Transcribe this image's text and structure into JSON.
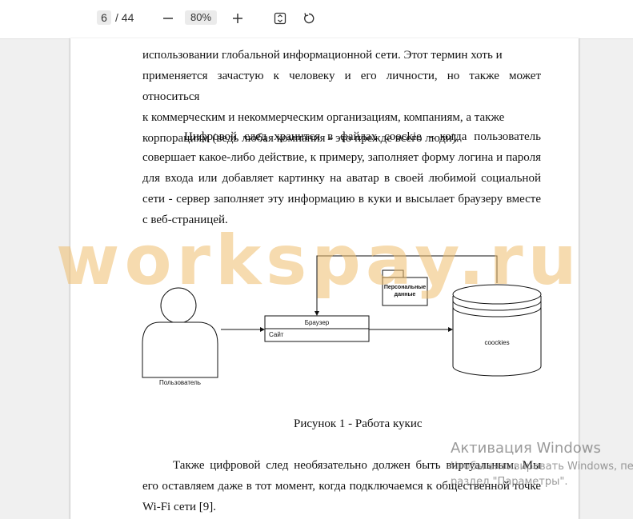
{
  "toolbar": {
    "current_page": "6",
    "page_total": "/ 44",
    "zoom": "80%",
    "zoom_out_icon": "minus-icon",
    "zoom_in_icon": "plus-icon",
    "fit_icon": "fit-page-icon",
    "rotate_icon": "rotate-icon"
  },
  "document": {
    "para1_lines": [
      "использовании глобальной информационной сети. Этот термин хоть и",
      "применяется зачастую к человеку и его личности, но также может относиться",
      "к коммерческим и некоммерческим организациям, компаниям, а также",
      "корпорациям (ведь любая компания - это прежде всего люди)."
    ],
    "para2_lines": [
      "Цифровой след хранится в файлах coockie - когда пользователь",
      "совершает какое-либо действие, к примеру, заполняет форму логина и пароля",
      "для входа или добавляет картинку на аватар в своей любимой социальной",
      "сети - сервер заполняет эту информацию в куки и высылает браузеру вместе",
      "с веб-страницей."
    ],
    "watermark": "workspay.ru",
    "diagram": {
      "user_label": "Пользователь",
      "browser_label": "Браузер",
      "site_label": "Сайт",
      "personal_data_label_1": "Персональные",
      "personal_data_label_2": "данные",
      "cookies_label": "coockies"
    },
    "caption": "Рисунок 1 - Работа кукис",
    "para3_lines": [
      "Также цифровой след необязательно должен быть виртуальным. Мы",
      "его оставляем даже в тот момент, когда подключаемся к общественной точке",
      "Wi-Fi сети [9]."
    ]
  },
  "activation": {
    "title": "Активация Windows",
    "line1": "Чтобы активировать Windows, пе",
    "line2": "раздел \"Параметры\"."
  }
}
